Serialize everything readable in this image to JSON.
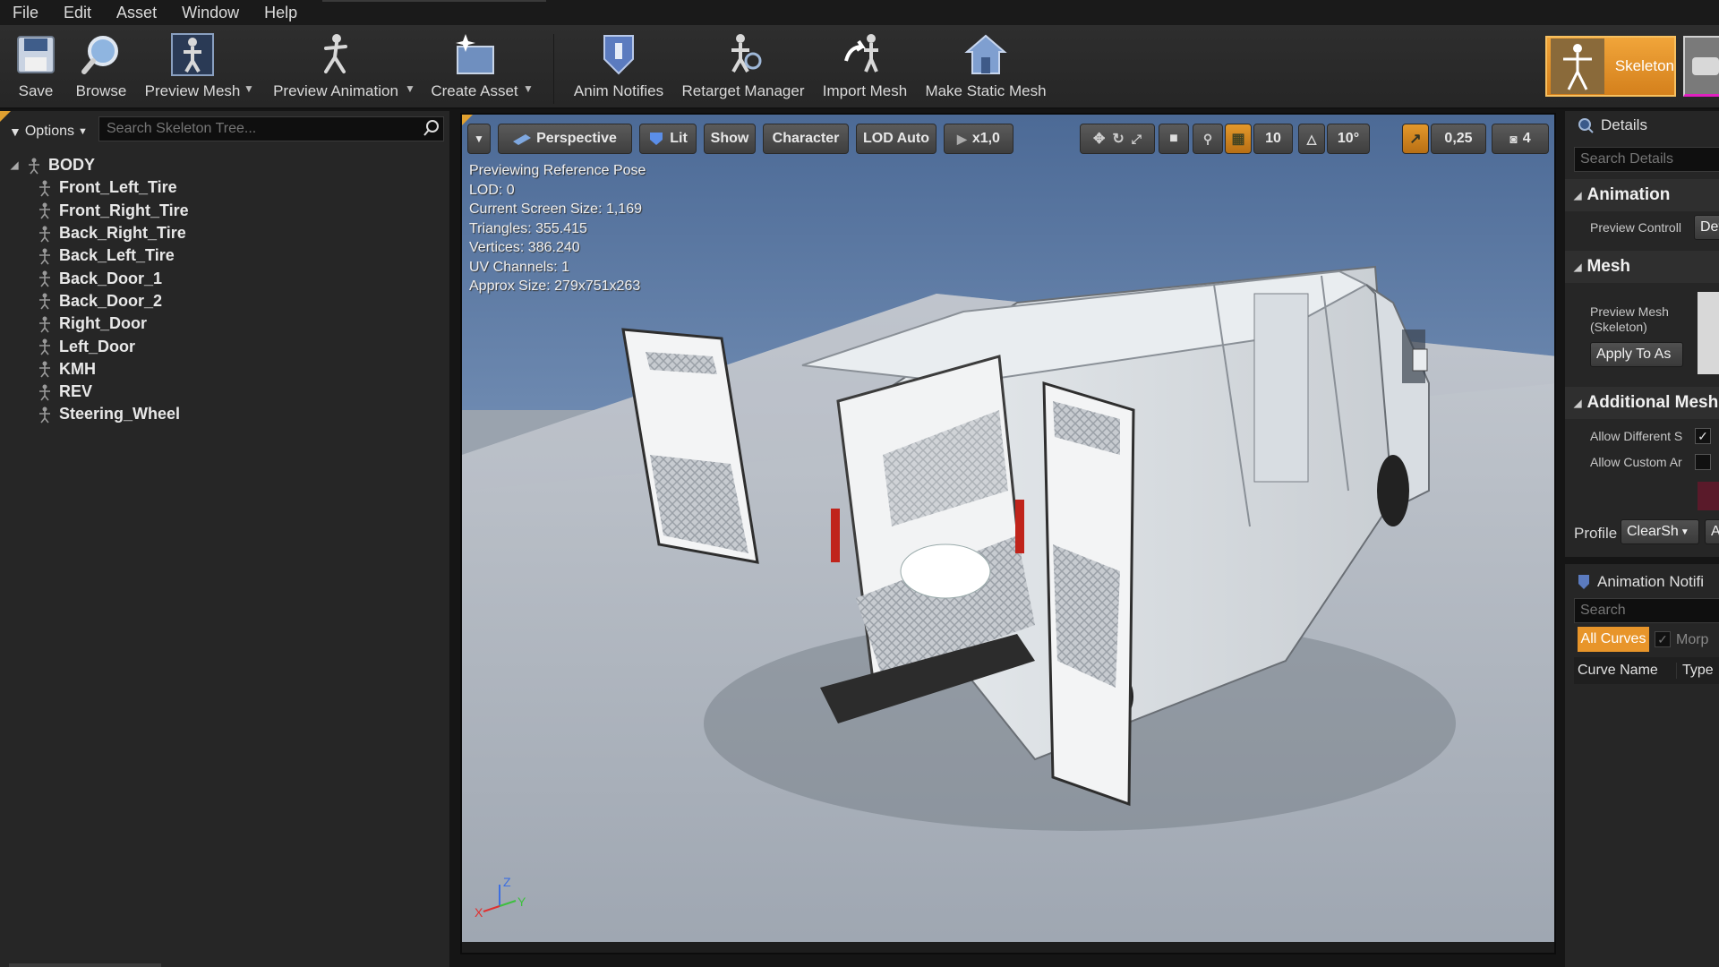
{
  "menu": [
    "File",
    "Edit",
    "Asset",
    "Window",
    "Help"
  ],
  "toolbar": {
    "save": "Save",
    "browse": "Browse",
    "preview_mesh": "Preview Mesh",
    "preview_animation": "Preview Animation",
    "create_asset": "Create Asset",
    "anim_notifies": "Anim Notifies",
    "retarget_manager": "Retarget Manager",
    "import_mesh": "Import Mesh",
    "make_static_mesh": "Make Static Mesh",
    "skeleton_tab": "Skeleton"
  },
  "skeleton_tree": {
    "options_label": "Options",
    "search_placeholder": "Search Skeleton Tree...",
    "root": "BODY",
    "bones": [
      "Front_Left_Tire",
      "Front_Right_Tire",
      "Back_Right_Tire",
      "Back_Left_Tire",
      "Back_Door_1",
      "Back_Door_2",
      "Right_Door",
      "Left_Door",
      "KMH",
      "REV",
      "Steering_Wheel"
    ]
  },
  "viewport": {
    "toolbar": {
      "perspective": "Perspective",
      "lit": "Lit",
      "show": "Show",
      "character": "Character",
      "lod": "LOD Auto",
      "play_rate": "x1,0",
      "grid_snap": "10",
      "rotation_snap": "10°",
      "scale_snap": "0,25",
      "camera_speed": "4"
    },
    "info": [
      "Previewing Reference Pose",
      "LOD: 0",
      "Current Screen Size: 1,169",
      "Triangles: 355.415",
      "Vertices: 386.240",
      "UV Channels: 1",
      "Approx Size: 279x751x263"
    ],
    "axes": {
      "x": "X",
      "y": "Y",
      "z": "Z"
    }
  },
  "details": {
    "title": "Details",
    "search_placeholder": "Search Details",
    "animation_section": "Animation",
    "preview_controller_label": "Preview Controll",
    "preview_controller_value": "Def",
    "mesh_section": "Mesh",
    "preview_mesh_label_1": "Preview Mesh",
    "preview_mesh_label_2": "(Skeleton)",
    "apply_button": "Apply To As",
    "additional_meshes_section": "Additional Meshe",
    "allow_different_label": "Allow Different S",
    "allow_different_checked": true,
    "allow_custom_label": "Allow Custom Ar",
    "allow_custom_checked": false,
    "profile_label": "Profile",
    "profile_value": "ClearSh",
    "profile_extra": "A"
  },
  "anim_notifies_panel": {
    "title": "Animation Notifi",
    "search_placeholder": "Search",
    "all_curves_button": "All Curves",
    "morph_label": "Morp",
    "column_curve_name": "Curve Name",
    "column_type": "Type"
  },
  "colors": {
    "accent_orange": "#e8952a",
    "panel_bg": "#262626",
    "viewport_sky": "#5b7aa6",
    "viewport_floor": "#a9b0ba",
    "mesh_tab_underline": "#e020c0"
  }
}
